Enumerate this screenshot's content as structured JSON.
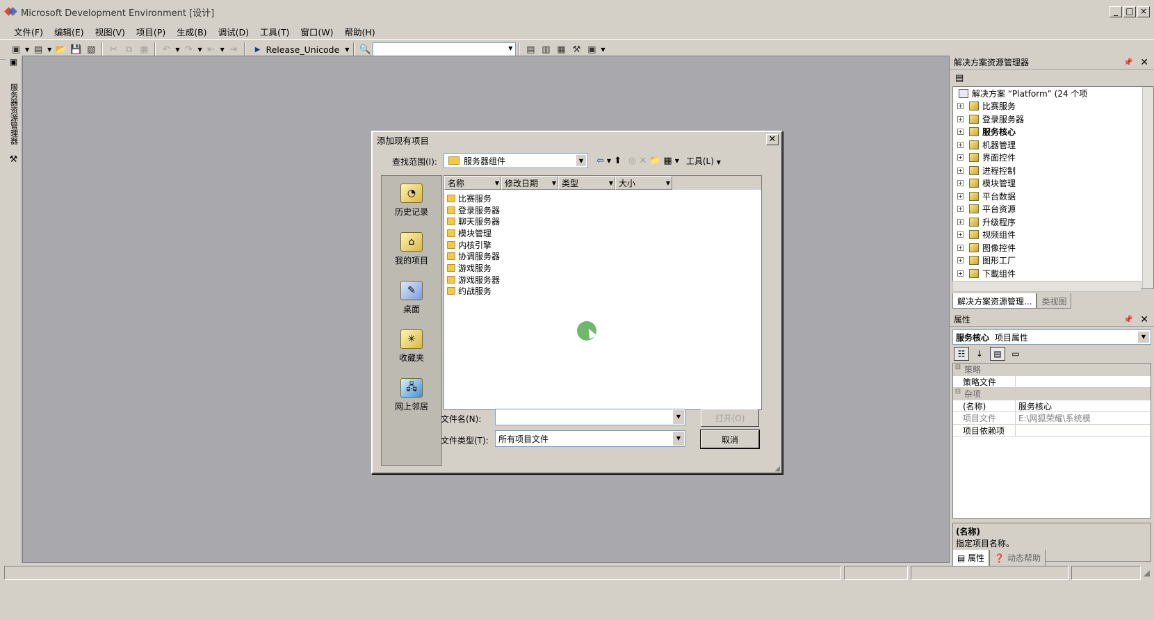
{
  "window": {
    "title": "Microsoft Development Environment [设计]",
    "controls": [
      "_",
      "□",
      "×"
    ]
  },
  "menu": [
    "文件(F)",
    "编辑(E)",
    "视图(V)",
    "项目(P)",
    "生成(B)",
    "调试(D)",
    "工具(T)",
    "窗口(W)",
    "帮助(H)"
  ],
  "toolbar": {
    "configuration": "Release_Unicode",
    "find_combo_value": ""
  },
  "left_toolwindow": {
    "label": "服务器资源管理器"
  },
  "solution_explorer": {
    "title": "解决方案资源管理器",
    "root": "解决方案 “Platform” (24 个项",
    "items": [
      "比赛服务",
      "登录服务器",
      "服务核心",
      "机器管理",
      "界面控件",
      "进程控制",
      "模块管理",
      "平台数据",
      "平台资源",
      "升级程序",
      "视频组件",
      "图像控件",
      "图形工厂",
      "下載组件"
    ],
    "bold_item": "服务核心",
    "tabs": [
      "解决方案资源管理...",
      "类视图"
    ]
  },
  "properties": {
    "title": "属性",
    "object_name": "服务核心",
    "object_type": "项目属性",
    "rows": [
      {
        "category": true,
        "name": "策略",
        "value": ""
      },
      {
        "name": "策略文件",
        "value": ""
      },
      {
        "category": true,
        "name": "杂项",
        "value": ""
      },
      {
        "name": "(名称)",
        "value": "服务核心"
      },
      {
        "name": "项目文件",
        "value": "E:\\网狐荣耀\\系统模",
        "dim": true
      },
      {
        "name": "项目依赖项",
        "value": ""
      }
    ],
    "desc_title": "(名称)",
    "desc_text": "指定项目名称。",
    "tabs": [
      "属性",
      "动态帮助"
    ]
  },
  "dialog": {
    "title": "添加现有项目",
    "lookin_label": "查找范围(I):",
    "lookin_value": "服务器组件",
    "tools_label": "工具(L)",
    "places": [
      "历史记录",
      "我的项目",
      "桌面",
      "收藏夹",
      "网上邻居"
    ],
    "columns": [
      "名称",
      "修改日期",
      "类型",
      "大小"
    ],
    "folders": [
      "比赛服务",
      "登录服务器",
      "聊天服务器",
      "模块管理",
      "内核引擎",
      "协调服务器",
      "游戏服务",
      "游戏服务器",
      "约战服务"
    ],
    "filename_label": "文件名(N):",
    "filename_value": "",
    "filetype_label": "文件类型(T):",
    "filetype_value": "所有项目文件",
    "open_button": "打开(O)",
    "cancel_button": "取消"
  }
}
